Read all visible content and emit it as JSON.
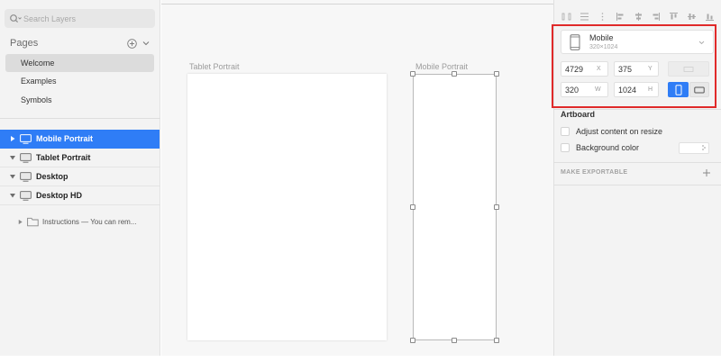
{
  "sidebar": {
    "search_placeholder": "Search Layers",
    "pages_title": "Pages",
    "pages": [
      {
        "label": "Welcome",
        "active": true
      },
      {
        "label": "Examples",
        "active": false
      },
      {
        "label": "Symbols",
        "active": false
      }
    ],
    "layers": [
      {
        "label": "Mobile Portrait",
        "selected": true,
        "expanded": false
      },
      {
        "label": "Tablet Portrait",
        "selected": false,
        "expanded": true
      },
      {
        "label": "Desktop",
        "selected": false,
        "expanded": true
      },
      {
        "label": "Desktop HD",
        "selected": false,
        "expanded": true
      }
    ],
    "child_layer": "Instructions — You can rem..."
  },
  "canvas": {
    "tablet_label": "Tablet Portrait",
    "mobile_label": "Mobile Portrait"
  },
  "inspector": {
    "device": {
      "name": "Mobile",
      "size": "320×1024"
    },
    "x": {
      "value": "4729",
      "label": "X"
    },
    "y": {
      "value": "375",
      "label": "Y"
    },
    "w": {
      "value": "320",
      "label": "W"
    },
    "h": {
      "value": "1024",
      "label": "H"
    },
    "artboard_title": "Artboard",
    "adjust_label": "Adjust content on resize",
    "background_label": "Background color",
    "export_title": "MAKE EXPORTABLE"
  },
  "colors": {
    "selection": "#2f7df6",
    "highlight": "#e02a2a"
  },
  "icons": [
    "search-icon",
    "add-page-icon",
    "chevron-down-icon",
    "disclosure-arrow-icon",
    "artboard-icon",
    "folder-icon",
    "phone-icon",
    "portrait-orientation-icon",
    "landscape-orientation-icon",
    "plus-icon"
  ]
}
